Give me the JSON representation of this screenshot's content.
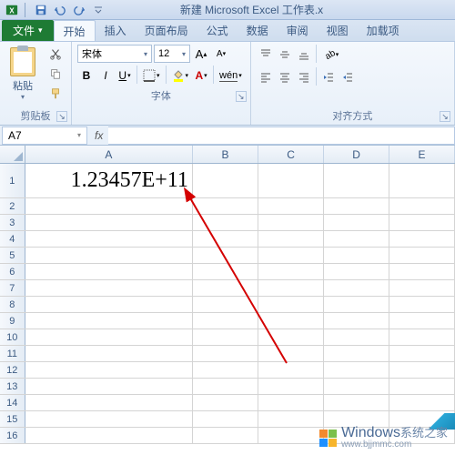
{
  "window": {
    "title": "新建 Microsoft Excel 工作表.x"
  },
  "qat": {
    "excel_icon": "excel-icon",
    "save": "save-icon",
    "undo": "undo-icon",
    "redo": "redo-icon"
  },
  "ribbon": {
    "file_label": "文件",
    "tabs": [
      "开始",
      "插入",
      "页面布局",
      "公式",
      "数据",
      "审阅",
      "视图",
      "加载项"
    ],
    "active_tab_index": 0,
    "clipboard": {
      "paste_label": "粘贴",
      "group_label": "剪贴板"
    },
    "font": {
      "family": "宋体",
      "size": "12",
      "group_label": "字体"
    },
    "alignment": {
      "group_label": "对齐方式"
    }
  },
  "name_box": {
    "value": "A7"
  },
  "formula_bar": {
    "fx_label": "fx",
    "value": ""
  },
  "columns": [
    "A",
    "B",
    "C",
    "D",
    "E"
  ],
  "rows": {
    "count": 16,
    "data": {
      "1": {
        "A": "1.23457E+11"
      }
    }
  },
  "watermark": {
    "brand": "Windows",
    "suffix": "系统之家",
    "url": "www.bjjmmc.com"
  }
}
